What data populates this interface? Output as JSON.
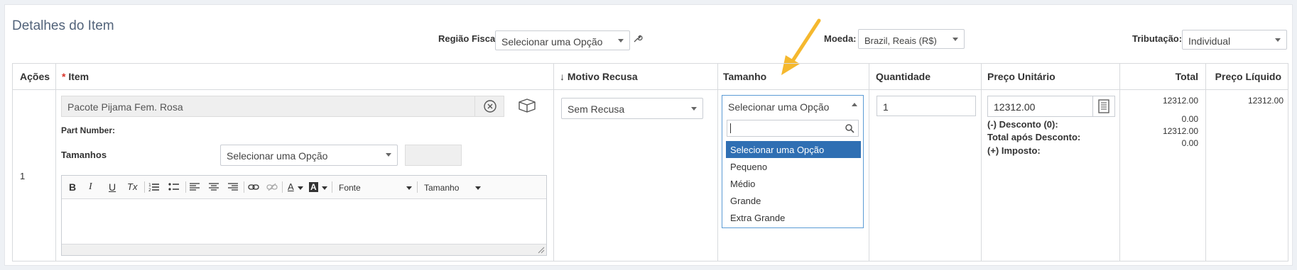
{
  "section_title": "Detalhes do Item",
  "header": {
    "regiao_label": "Região Fiscal:",
    "regiao_value": "Selecionar uma Opção",
    "moeda_label": "Moeda:",
    "moeda_value": "Brazil, Reais (R$)",
    "tributacao_label": "Tributação:",
    "tributacao_value": "Individual"
  },
  "columns": {
    "acoes": "Ações",
    "item_required": "*",
    "item": "Item",
    "motivo_arrow": "↓",
    "motivo": "Motivo Recusa",
    "tamanho": "Tamanho",
    "quantidade": "Quantidade",
    "preco_unitario": "Preço Unitário",
    "total": "Total",
    "preco_liquido": "Preço Líquido"
  },
  "row": {
    "index": "1",
    "item_name": "Pacote Pijama Fem. Rosa",
    "part_number_label": "Part Number:",
    "tamanhos_label": "Tamanhos",
    "tamanhos_value": "Selecionar uma Opção",
    "motivo_value": "Sem Recusa",
    "tamanho_value": "Selecionar uma Opção",
    "quantidade": "1",
    "preco_unitario": "12312.00",
    "desconto_label": "(-) Desconto (0):",
    "total_apos_label": "Total após Desconto:",
    "imposto_label": "(+) Imposto:",
    "total": "12312.00",
    "desconto_value": "0.00",
    "total_apos_value": "12312.00",
    "imposto_value": "0.00",
    "preco_liquido": "12312.00"
  },
  "editor": {
    "bold": "B",
    "italic": "I",
    "underline": "U",
    "clear_format": "Tx",
    "font_color": "A",
    "bg_color": "A",
    "font_select": "Fonte",
    "size_select": "Tamanho"
  },
  "tamanho_dropdown": {
    "options": [
      "Selecionar uma Opção",
      "Pequeno",
      "Médio",
      "Grande",
      "Extra Grande"
    ],
    "selected_index": 0
  },
  "colors": {
    "accent": "#2f6fb3",
    "required": "#d9342b",
    "arrow": "#f5b82e",
    "title": "#52637a"
  }
}
